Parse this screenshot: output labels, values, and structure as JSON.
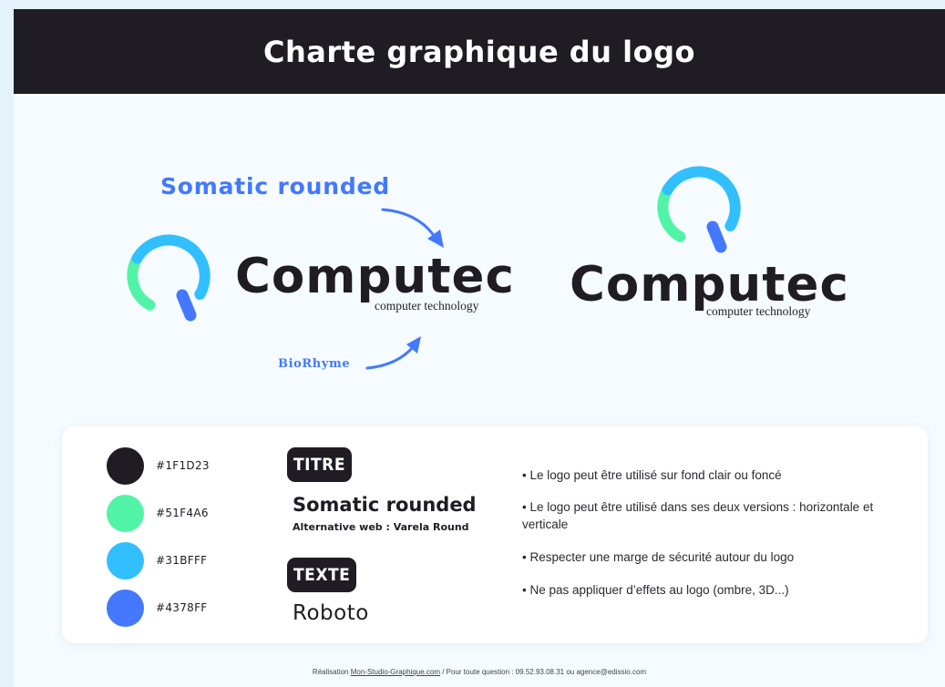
{
  "header": {
    "title": "Charte graphique du logo"
  },
  "fonts_annotations": {
    "title_font": "Somatic rounded",
    "text_font": "BioRhyme"
  },
  "logo_horizontal": {
    "wordmark": "Computec",
    "tagline": "computer technology"
  },
  "logo_vertical": {
    "wordmark": "Computec",
    "tagline": "computer technology"
  },
  "palette": [
    {
      "hex": "#1F1D23",
      "color": "#1f1d23"
    },
    {
      "hex": "#51F4A6",
      "color": "#51f4a6"
    },
    {
      "hex": "#31BFFF",
      "color": "#31bfff"
    },
    {
      "hex": "#4378FF",
      "color": "#4378ff"
    }
  ],
  "typography": {
    "title_tag": "TITRE",
    "title_font": "Somatic rounded",
    "title_alt": "Alternative web : Varela Round",
    "text_tag": "TEXTE",
    "text_font": "Roboto"
  },
  "rules": [
    "• Le logo peut être utilisé sur fond clair ou foncé",
    "• Le logo peut être utilisé dans ses deux versions : horizontale et verticale",
    "• Respecter une marge de sécurité autour du logo",
    "• Ne pas appliquer d’effets au logo (ombre, 3D...)"
  ],
  "footer": {
    "prefix": "Réalisation ",
    "link": "Mon-Studio-Graphique.com",
    "suffix": " / Pour toute question : 09.52.93.08.31 ou agence@edissio.com"
  }
}
